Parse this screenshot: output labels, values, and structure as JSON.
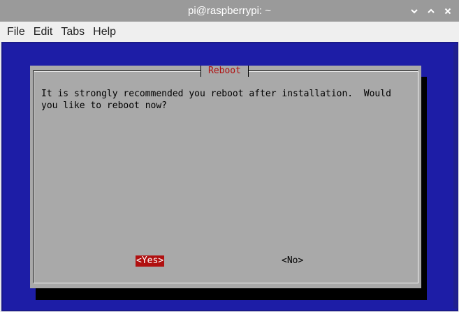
{
  "window": {
    "title": "pi@raspberrypi: ~",
    "controls": [
      "minimize-icon",
      "maximize-icon",
      "close-icon"
    ]
  },
  "menu": {
    "items": [
      "File",
      "Edit",
      "Tabs",
      "Help"
    ]
  },
  "dialog": {
    "title": "Reboot",
    "message": "It is strongly recommended you reboot after installation.  Would\nyou like to reboot now?",
    "yes_label": "<Yes>",
    "no_label": "<No>"
  },
  "colors": {
    "terminal_bg": "#1d1da6",
    "dialog_bg": "#a9a9a9",
    "accent_red": "#b01010",
    "titlebar_bg": "#9a9a9a"
  }
}
